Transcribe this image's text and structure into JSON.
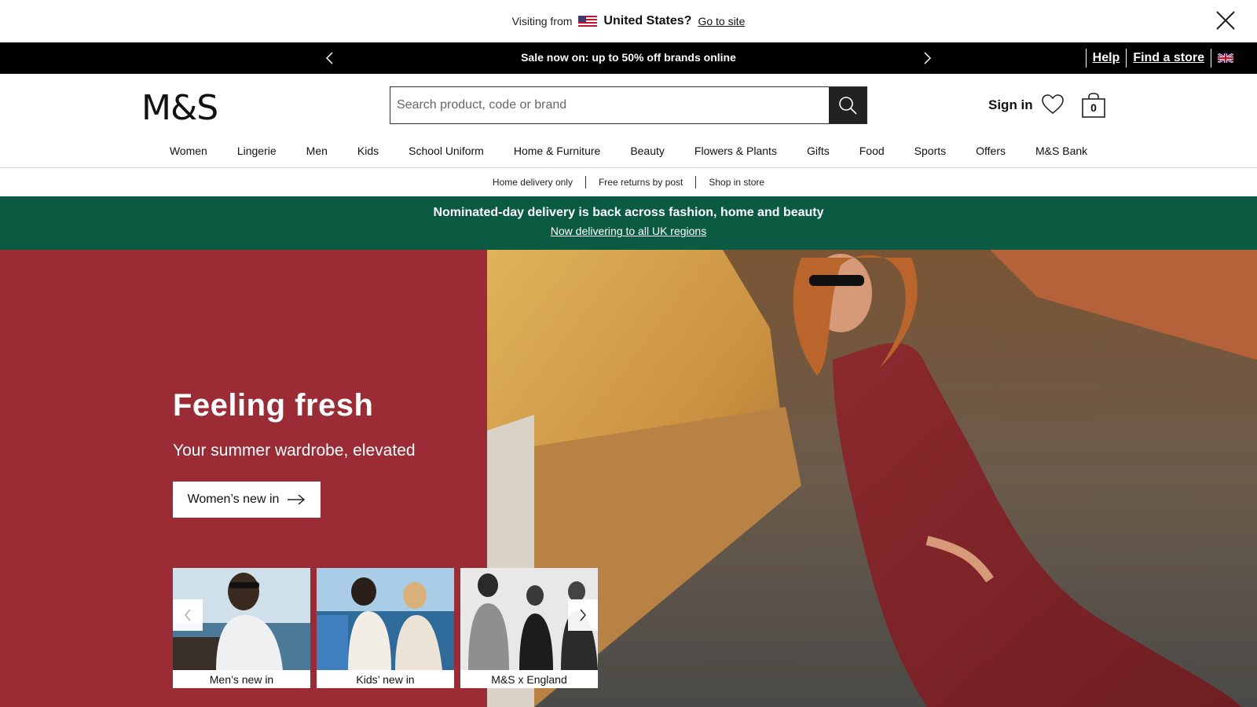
{
  "geo_banner": {
    "visiting_from": "Visiting from",
    "country": "United States?",
    "go_to_site": "Go to site"
  },
  "promo_bar": {
    "message": "Sale now on: up to 50% off brands online",
    "help": "Help",
    "find_store": "Find a store"
  },
  "header": {
    "logo": "M&S",
    "search_placeholder": "Search product, code or brand",
    "sign_in": "Sign in",
    "bag_count": "0"
  },
  "nav": {
    "items": [
      "Women",
      "Lingerie",
      "Men",
      "Kids",
      "School Uniform",
      "Home & Furniture",
      "Beauty",
      "Flowers & Plants",
      "Gifts",
      "Food",
      "Sports",
      "Offers",
      "M&S Bank"
    ]
  },
  "service_bar": {
    "items": [
      "Home delivery only",
      "Free returns by post",
      "Shop in store"
    ]
  },
  "green_banner": {
    "title": "Nominated-day delivery is back across fashion, home and beauty",
    "link": "Now delivering to all UK regions"
  },
  "hero": {
    "title": "Feeling fresh",
    "subtitle": "Your summer wardrobe, elevated",
    "cta": "Women’s new in",
    "cards": [
      {
        "label": "Men’s new in"
      },
      {
        "label": "Kids’ new in"
      },
      {
        "label": "M&S x England"
      }
    ]
  },
  "colors": {
    "hero_left": "#9b2c35",
    "green_banner": "#0b5b42",
    "promo_bar": "#000000"
  }
}
